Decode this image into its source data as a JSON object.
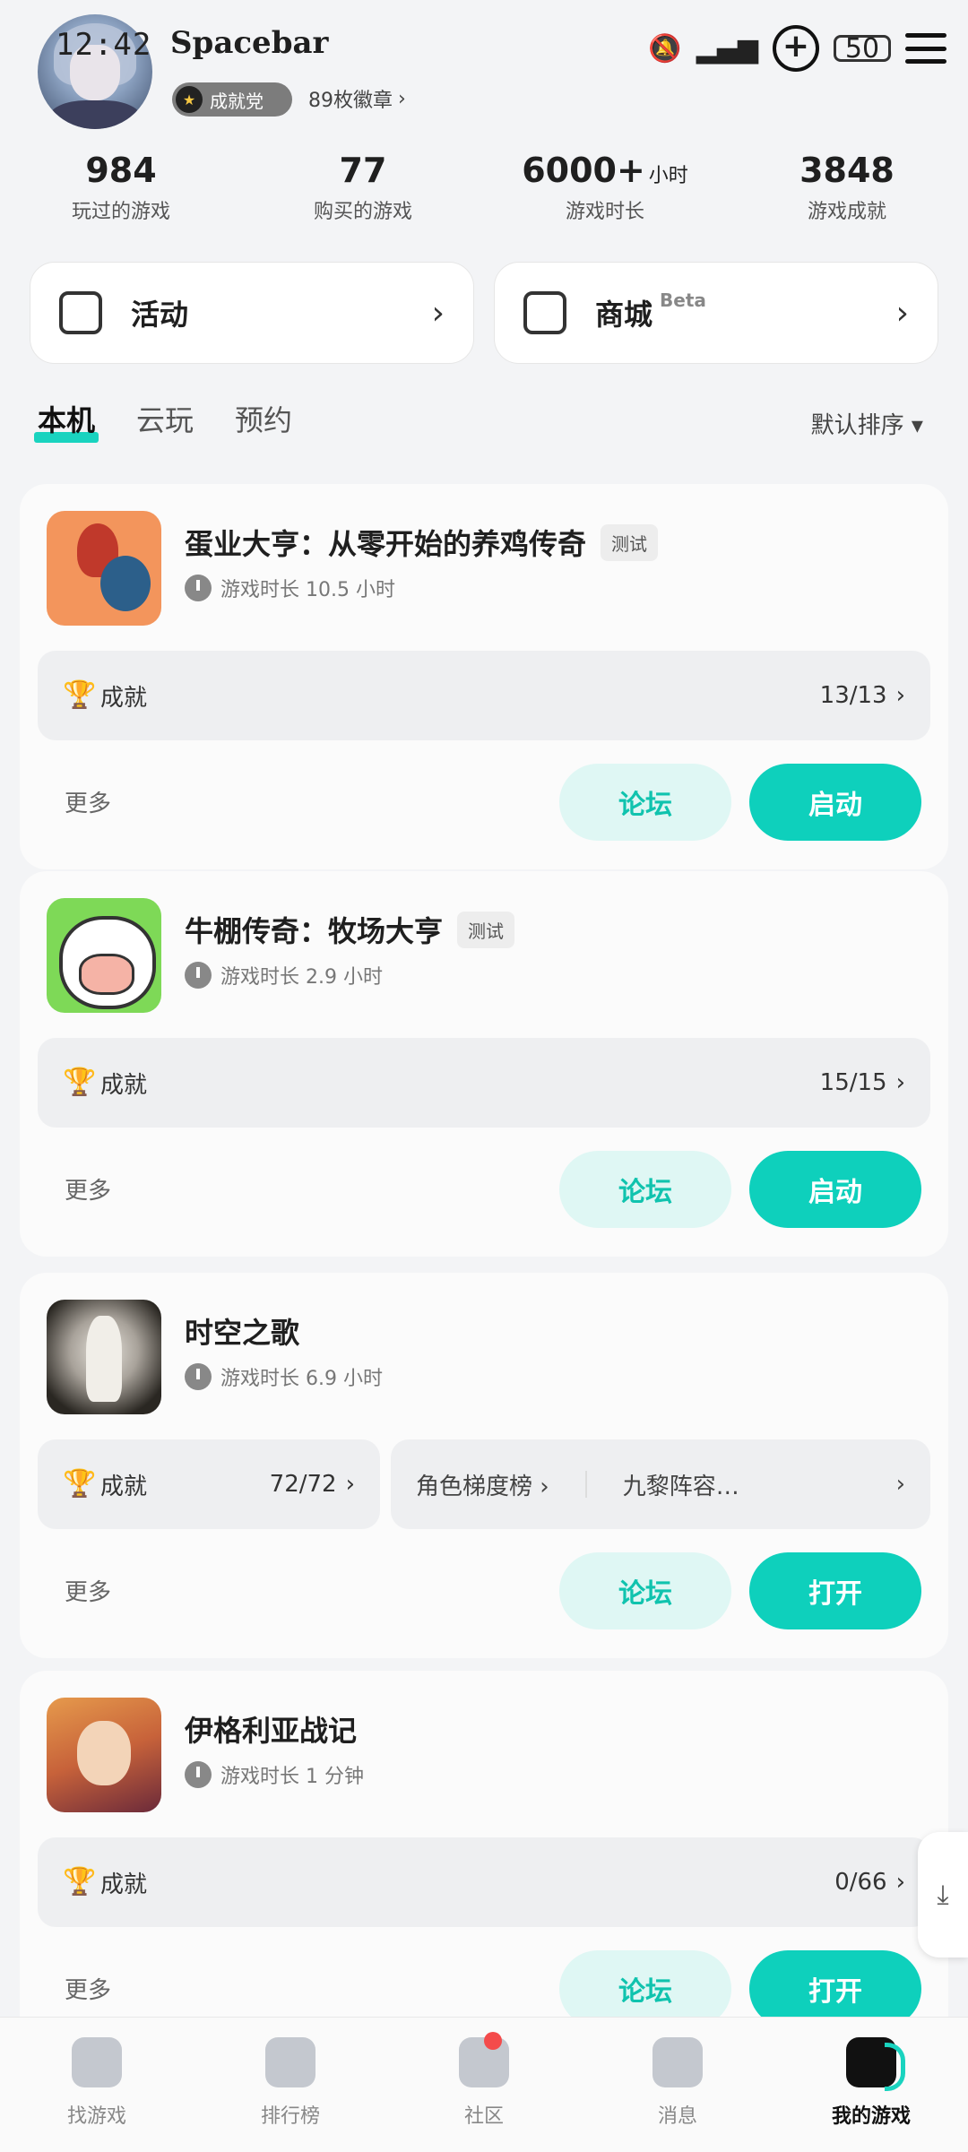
{
  "status_bar": {
    "time": "12:42",
    "battery": "50"
  },
  "profile": {
    "username": "Spacebar",
    "badge_label": "成就党",
    "badge_count_text": "89枚徽章"
  },
  "stats": [
    {
      "value": "984",
      "unit": "",
      "label": "玩过的游戏"
    },
    {
      "value": "77",
      "unit": "",
      "label": "购买的游戏"
    },
    {
      "value": "6000+",
      "unit": "小时",
      "label": "游戏时长"
    },
    {
      "value": "3848",
      "unit": "",
      "label": "游戏成就"
    }
  ],
  "quick_cards": [
    {
      "label": "活动",
      "beta": ""
    },
    {
      "label": "商城",
      "beta": "Beta"
    }
  ],
  "tabs": [
    "本机",
    "云玩",
    "预约"
  ],
  "sort_label": "默认排序 ▾",
  "games": [
    {
      "title": "蛋业大亨：从零开始的养鸡传奇",
      "tag": "测试",
      "playtime": "游戏时长 10.5 小时",
      "achievement_label": "成就",
      "achievement_count": "13/13",
      "more": "更多",
      "forum": "论坛",
      "action": "启动"
    },
    {
      "title": "牛棚传奇：牧场大亨",
      "tag": "测试",
      "playtime": "游戏时长 2.9 小时",
      "achievement_label": "成就",
      "achievement_count": "15/15",
      "more": "更多",
      "forum": "论坛",
      "action": "启动"
    },
    {
      "title": "时空之歌",
      "tag": "",
      "playtime": "游戏时长 6.9 小时",
      "achievement_label": "成就",
      "achievement_count": "72/72",
      "extra_link_1": "角色梯度榜",
      "extra_link_2": "九黎阵容…",
      "more": "更多",
      "forum": "论坛",
      "action": "打开"
    },
    {
      "title": "伊格利亚战记",
      "tag": "",
      "playtime": "游戏时长 1 分钟",
      "achievement_label": "成就",
      "achievement_count": "0/66",
      "more": "更多",
      "forum": "论坛",
      "action": "打开"
    }
  ],
  "bottom_nav": [
    {
      "label": "找游戏",
      "icon": "find-games-icon"
    },
    {
      "label": "排行榜",
      "icon": "ranking-icon"
    },
    {
      "label": "社区",
      "icon": "community-icon"
    },
    {
      "label": "消息",
      "icon": "message-icon"
    },
    {
      "label": "我的游戏",
      "icon": "my-games-icon"
    }
  ],
  "colors": {
    "accent": "#0ed0bc",
    "accent_light": "#dff7f4",
    "notification": "#f44b4b"
  }
}
